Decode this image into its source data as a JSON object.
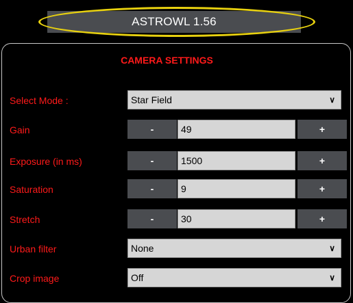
{
  "app": {
    "title": "ASTROWL 1.56"
  },
  "panel": {
    "title": "CAMERA SETTINGS",
    "mode": {
      "label": "Select Mode :",
      "value": "Star Field"
    },
    "gain": {
      "label": "Gain",
      "minus": "-",
      "value": "49",
      "plus": "+"
    },
    "exposure": {
      "label": "Exposure (in ms)",
      "minus": "-",
      "value": "1500",
      "plus": "+"
    },
    "saturation": {
      "label": "Saturation",
      "minus": "-",
      "value": "9",
      "plus": "+"
    },
    "stretch": {
      "label": "Stretch",
      "minus": "-",
      "value": "30",
      "plus": "+"
    },
    "urban_filter": {
      "label": "Urban filter",
      "value": "None"
    },
    "crop_image": {
      "label": "Crop image",
      "value": "Off"
    }
  },
  "colors": {
    "label_red": "#ff1a1a",
    "highlight_yellow": "#e8d10f",
    "button_gray": "#4a4c50",
    "field_gray": "#d6d6d6"
  },
  "icons": {
    "dropdown": "chevron-down-icon"
  }
}
